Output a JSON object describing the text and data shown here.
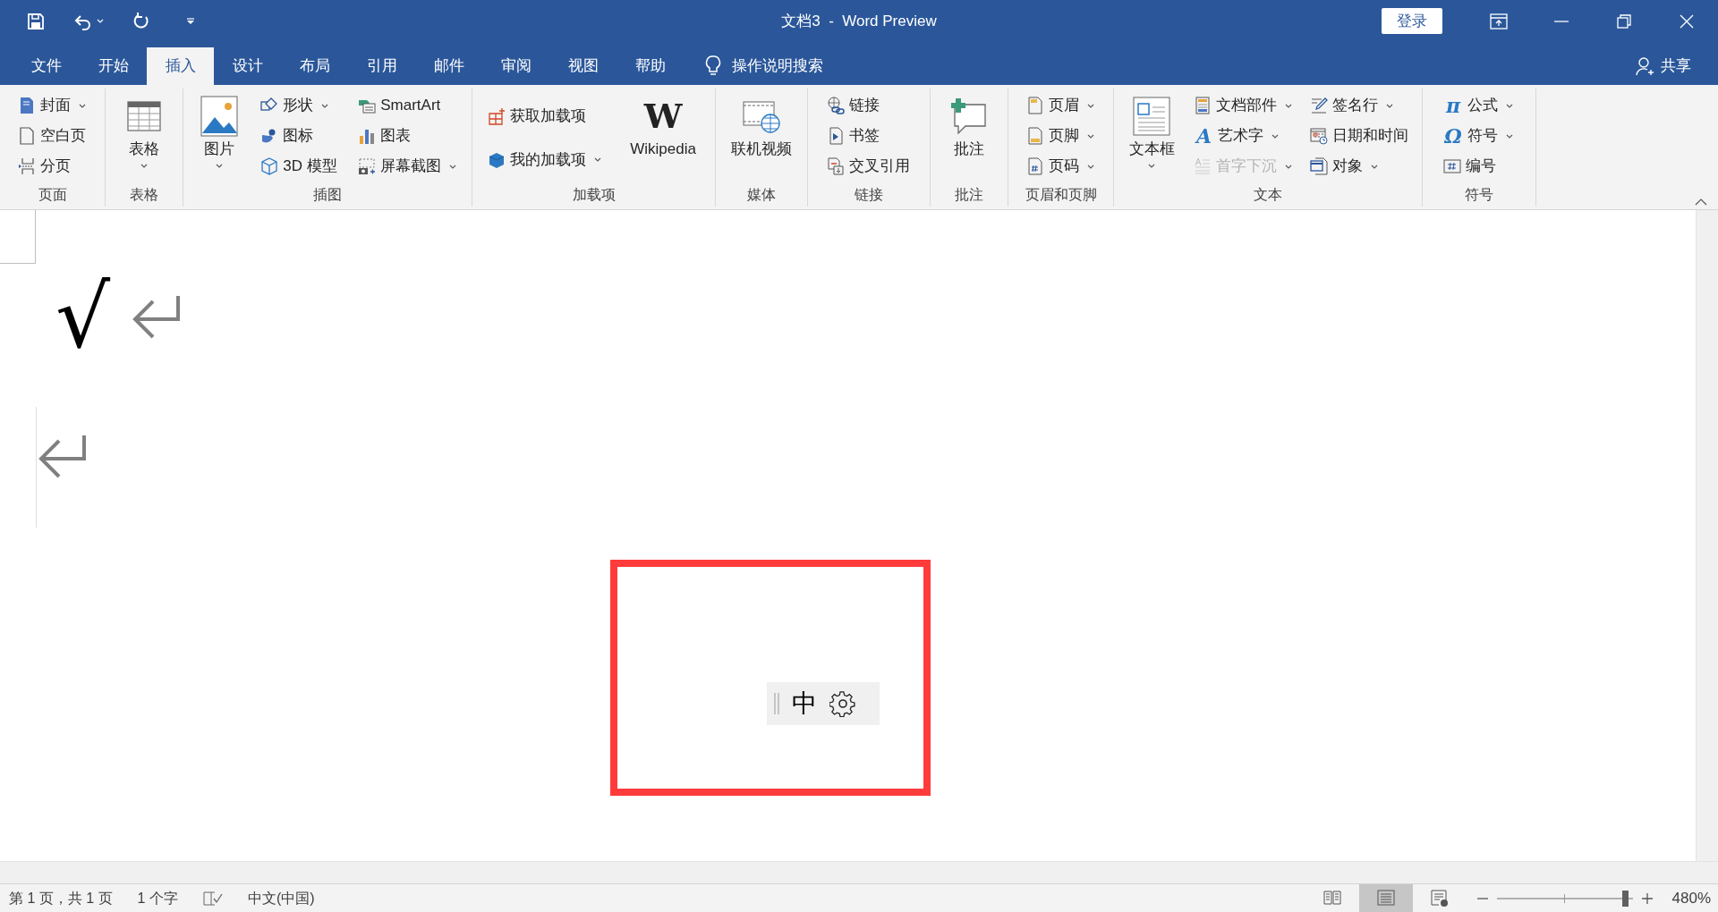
{
  "window": {
    "title": "文档3  -  Word Preview",
    "sign_in": "登录"
  },
  "tabs": [
    {
      "label": "文件",
      "selected": false
    },
    {
      "label": "开始",
      "selected": false
    },
    {
      "label": "插入",
      "selected": true
    },
    {
      "label": "设计",
      "selected": false
    },
    {
      "label": "布局",
      "selected": false
    },
    {
      "label": "引用",
      "selected": false
    },
    {
      "label": "邮件",
      "selected": false
    },
    {
      "label": "审阅",
      "selected": false
    },
    {
      "label": "视图",
      "selected": false
    },
    {
      "label": "帮助",
      "selected": false
    }
  ],
  "tell_me": "操作说明搜索",
  "share": "共享",
  "ribbon": [
    {
      "label": "页面",
      "items": [
        {
          "kind": "small",
          "label": "封面",
          "dropdown": true
        },
        {
          "kind": "small",
          "label": "空白页",
          "dropdown": false
        },
        {
          "kind": "small",
          "label": "分页",
          "dropdown": false
        }
      ]
    },
    {
      "label": "表格",
      "items": [
        {
          "kind": "large",
          "label": "表格",
          "dropdown": true
        }
      ]
    },
    {
      "label": "插图",
      "items": [
        {
          "kind": "large",
          "label": "图片",
          "dropdown": true
        },
        {
          "kind": "small",
          "label": "形状",
          "dropdown": true
        },
        {
          "kind": "small",
          "label": "图标",
          "dropdown": false
        },
        {
          "kind": "small",
          "label": "3D 模型",
          "dropdown": false
        },
        {
          "kind": "small",
          "label": "SmartArt",
          "dropdown": false
        },
        {
          "kind": "small",
          "label": "图表",
          "dropdown": false
        },
        {
          "kind": "small",
          "label": "屏幕截图",
          "dropdown": true
        }
      ]
    },
    {
      "label": "加载项",
      "items": [
        {
          "kind": "small",
          "label": "获取加载项",
          "dropdown": false
        },
        {
          "kind": "small",
          "label": "我的加载项",
          "dropdown": true
        },
        {
          "kind": "large",
          "label": "Wikipedia",
          "dropdown": false,
          "icon_glyph": "W"
        }
      ]
    },
    {
      "label": "媒体",
      "items": [
        {
          "kind": "large",
          "label": "联机视频",
          "dropdown": false
        }
      ]
    },
    {
      "label": "链接",
      "items": [
        {
          "kind": "small",
          "label": "链接",
          "dropdown": false
        },
        {
          "kind": "small",
          "label": "书签",
          "dropdown": false
        },
        {
          "kind": "small",
          "label": "交叉引用",
          "dropdown": false
        }
      ]
    },
    {
      "label": "批注",
      "items": [
        {
          "kind": "large",
          "label": "批注",
          "dropdown": false
        }
      ]
    },
    {
      "label": "页眉和页脚",
      "items": [
        {
          "kind": "small",
          "label": "页眉",
          "dropdown": true
        },
        {
          "kind": "small",
          "label": "页脚",
          "dropdown": true
        },
        {
          "kind": "small",
          "label": "页码",
          "dropdown": true
        }
      ]
    },
    {
      "label": "文本",
      "items": [
        {
          "kind": "large",
          "label": "文本框",
          "dropdown": true
        },
        {
          "kind": "small",
          "label": "文档部件",
          "dropdown": true
        },
        {
          "kind": "small",
          "label": "艺术字",
          "dropdown": true,
          "icon_glyph": "A"
        },
        {
          "kind": "small",
          "label": "首字下沉",
          "dropdown": true,
          "disabled": true
        },
        {
          "kind": "small",
          "label": "签名行",
          "dropdown": true
        },
        {
          "kind": "small",
          "label": "日期和时间",
          "dropdown": false
        },
        {
          "kind": "small",
          "label": "对象",
          "dropdown": true
        }
      ]
    },
    {
      "label": "符号",
      "items": [
        {
          "kind": "small",
          "label": "公式",
          "dropdown": true,
          "icon_glyph": "π"
        },
        {
          "kind": "small",
          "label": "符号",
          "dropdown": true,
          "icon_glyph": "Ω"
        },
        {
          "kind": "small",
          "label": "编号",
          "dropdown": false
        }
      ]
    }
  ],
  "document": {
    "text": "√"
  },
  "ime_toolbar": {
    "mode": "中"
  },
  "status_bar": {
    "page": "第 1 页，共 1 页",
    "words": "1 个字",
    "language": "中文(中国)",
    "zoom": "480%",
    "zoom_slider": {
      "level": 0.97
    },
    "views": [
      {
        "selected": false
      },
      {
        "selected": true
      },
      {
        "selected": false
      }
    ]
  }
}
